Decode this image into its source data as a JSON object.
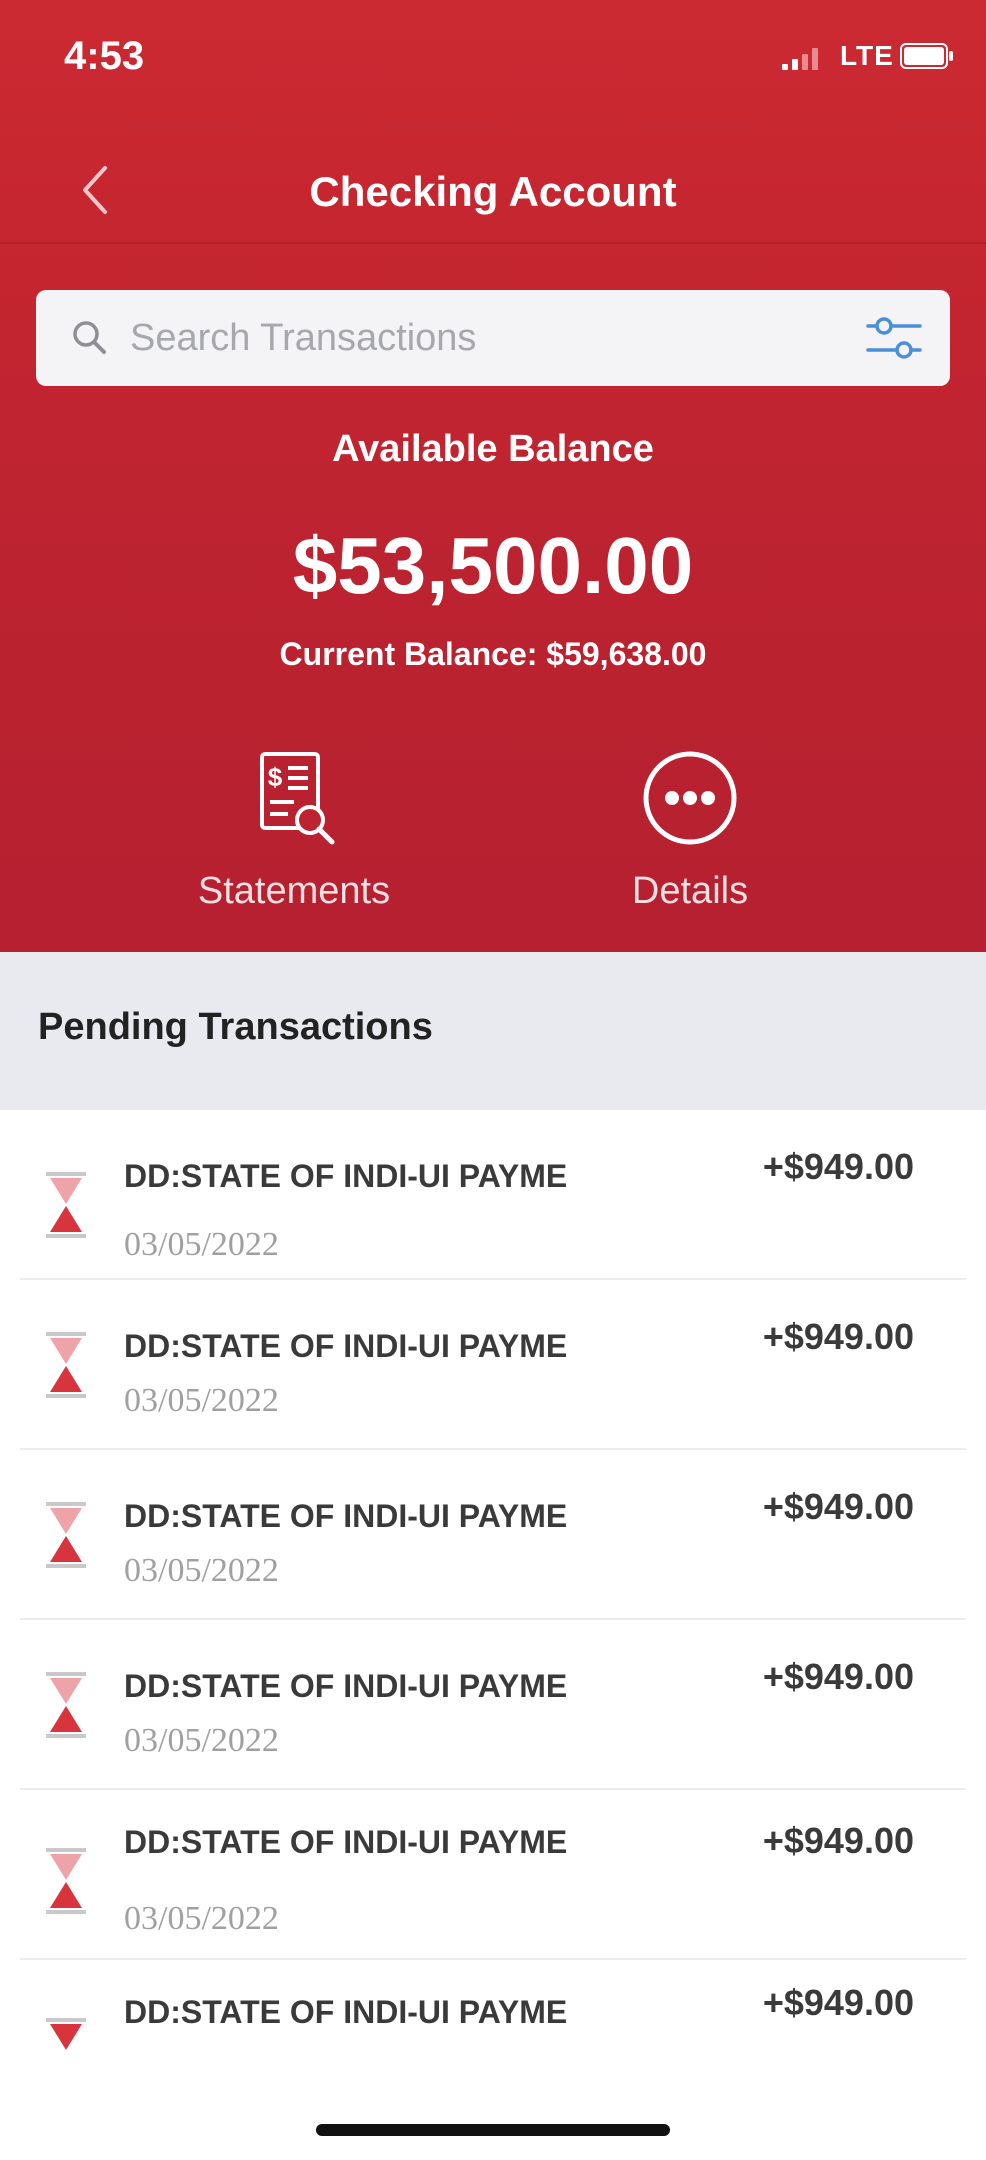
{
  "status_bar": {
    "time": "4:53",
    "network": "LTE",
    "icons": [
      "signal-icon",
      "battery-icon"
    ]
  },
  "nav": {
    "title": "Checking Account",
    "back_icon": "chevron-left-icon"
  },
  "search": {
    "placeholder": "Search Transactions",
    "value": "",
    "filter_icon": "filter-sliders-icon"
  },
  "balance": {
    "label": "Available Balance",
    "value": "$53,500.00",
    "current": "Current Balance: $59,638.00"
  },
  "actions": [
    {
      "label": "Statements",
      "icon": "statement-search-icon"
    },
    {
      "label": "Details",
      "icon": "more-dots-icon"
    }
  ],
  "pending": {
    "title": "Pending Transactions",
    "items": [
      {
        "name": "DD:STATE OF INDI-UI PAYME",
        "date": "03/05/2022",
        "amount": "+$949.00"
      },
      {
        "name": "DD:STATE OF INDI-UI PAYME",
        "date": "03/05/2022",
        "amount": "+$949.00"
      },
      {
        "name": "DD:STATE OF INDI-UI PAYME",
        "date": "03/05/2022",
        "amount": "+$949.00"
      },
      {
        "name": "DD:STATE OF INDI-UI PAYME",
        "date": "03/05/2022",
        "amount": "+$949.00"
      },
      {
        "name": "DD:STATE OF INDI-UI PAYME",
        "date": "03/05/2022",
        "amount": "+$949.00"
      },
      {
        "name": "DD:STATE OF INDI-UI PAYME",
        "date": "",
        "amount": "+$949.00"
      }
    ],
    "item_icon": "hourglass-icon"
  },
  "colors": {
    "brand_red": "#c6262f",
    "header_red_dark": "#b62030",
    "filter_blue": "#4a90d9",
    "hourglass_red": "#d8343d",
    "section_bg": "#e9eaef"
  }
}
